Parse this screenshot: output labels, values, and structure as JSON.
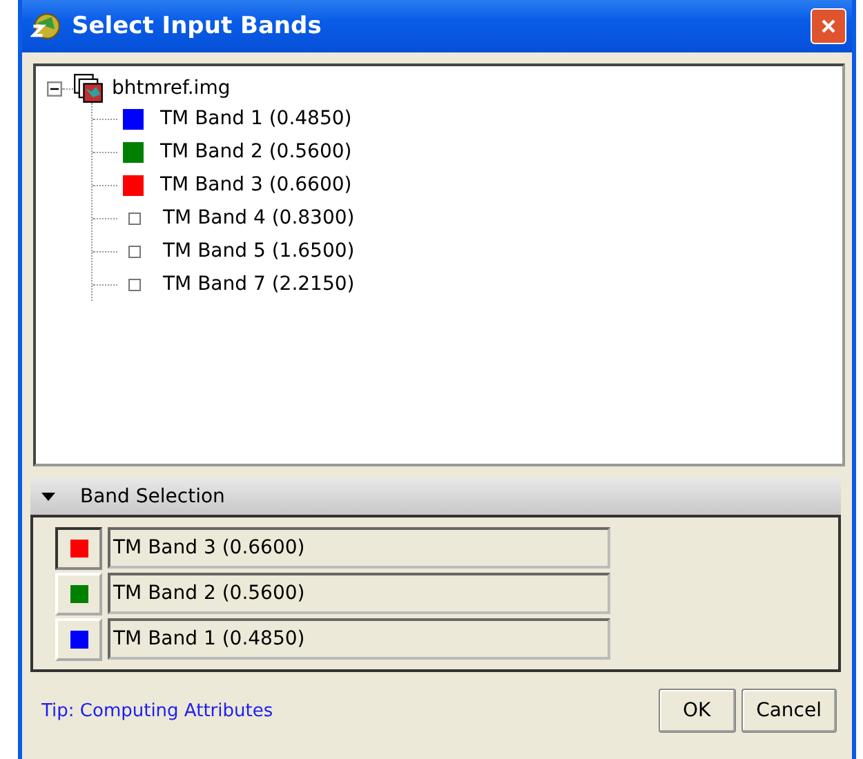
{
  "window": {
    "title": "Select Input Bands"
  },
  "tree": {
    "label": "bhtmref.img",
    "expanded": true,
    "children": [
      {
        "label": "TM Band 1 (0.4850)",
        "kind": "assigned",
        "color": "#0000ff"
      },
      {
        "label": "TM Band 2 (0.5600)",
        "kind": "assigned",
        "color": "#008000"
      },
      {
        "label": "TM Band 3 (0.6600)",
        "kind": "assigned",
        "color": "#ff0000"
      },
      {
        "label": "TM Band 4 (0.8300)",
        "kind": "unassigned"
      },
      {
        "label": "TM Band 5 (1.6500)",
        "kind": "unassigned"
      },
      {
        "label": "TM Band 7 (2.2150)",
        "kind": "unassigned"
      }
    ]
  },
  "band_selection": {
    "title": "Band Selection",
    "expanded": true,
    "rows": [
      {
        "value": "TM Band 3 (0.6600)",
        "color": "#ff0000",
        "selected": true
      },
      {
        "value": "TM Band 2 (0.5600)",
        "color": "#008000",
        "selected": false
      },
      {
        "value": "TM Band 1 (0.4850)",
        "color": "#0000ff",
        "selected": false
      }
    ]
  },
  "tip": "Tip: Computing Attributes",
  "buttons": [
    "OK",
    "Cancel"
  ]
}
